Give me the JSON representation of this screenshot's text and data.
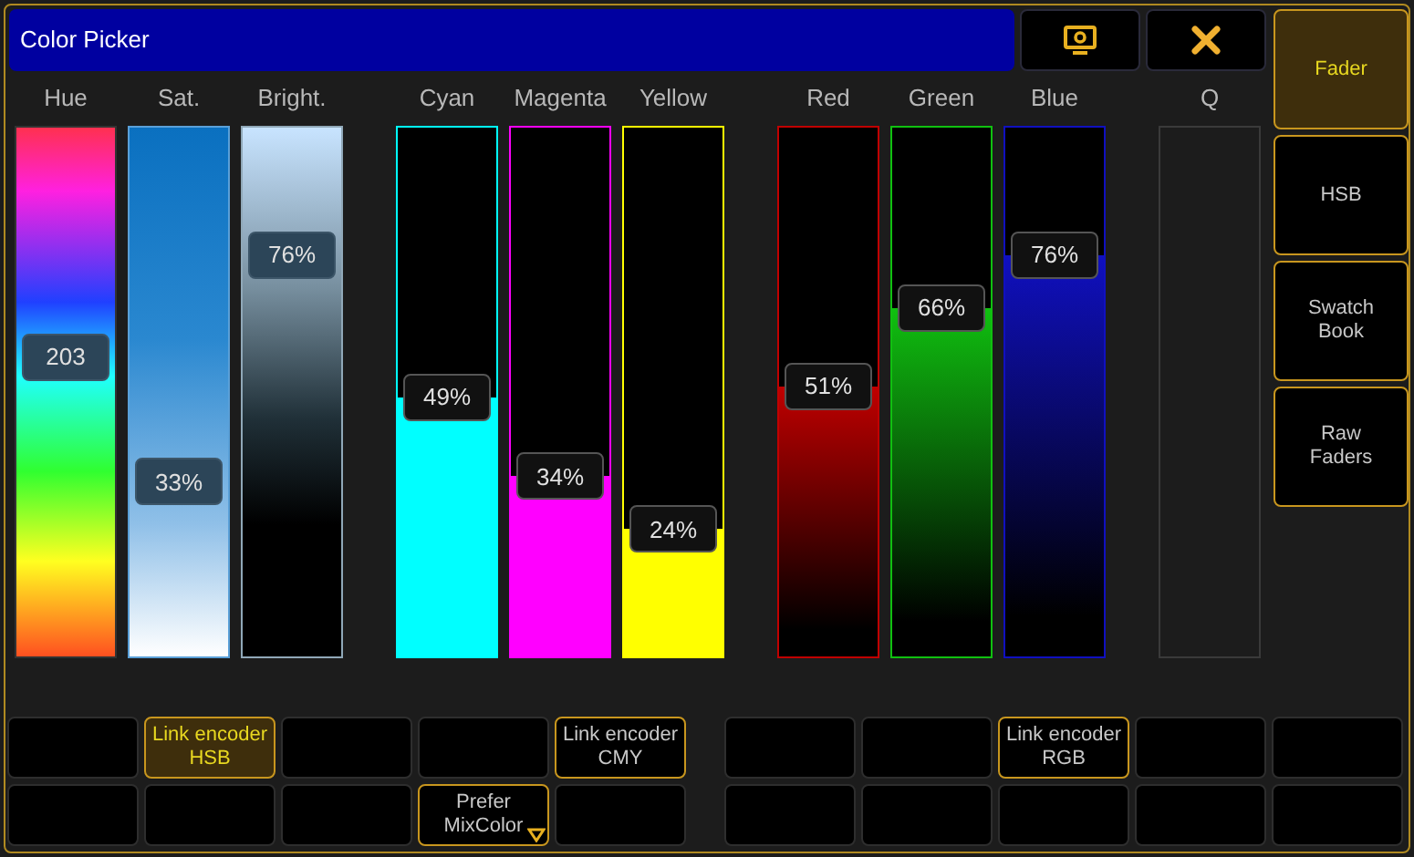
{
  "window": {
    "title": "Color Picker"
  },
  "fader_groups": [
    {
      "faders": [
        {
          "kind": "hue",
          "label": "Hue",
          "reading": "203",
          "level": 0.565
        },
        {
          "kind": "saturation",
          "label": "Sat.",
          "reading": "33%",
          "level": 0.33
        },
        {
          "kind": "brightness",
          "label": "Bright.",
          "reading": "76%",
          "level": 0.76
        }
      ]
    },
    {
      "faders": [
        {
          "kind": "solid",
          "label": "Cyan",
          "reading": "49%",
          "level": 0.49,
          "color": "#00ffff"
        },
        {
          "kind": "solid",
          "label": "Magenta",
          "reading": "34%",
          "level": 0.34,
          "color": "#ff00ff"
        },
        {
          "kind": "solid",
          "label": "Yellow",
          "reading": "24%",
          "level": 0.24,
          "color": "#ffff00"
        }
      ]
    },
    {
      "faders": [
        {
          "kind": "fade",
          "label": "Red",
          "reading": "51%",
          "level": 0.51,
          "color": "#c00000"
        },
        {
          "kind": "fade",
          "label": "Green",
          "reading": "66%",
          "level": 0.66,
          "color": "#10c010"
        },
        {
          "kind": "fade",
          "label": "Blue",
          "reading": "76%",
          "level": 0.76,
          "color": "#1010c0"
        }
      ]
    },
    {
      "faders": [
        {
          "kind": "empty",
          "label": "Q"
        }
      ]
    }
  ],
  "sidebar": {
    "items": [
      {
        "label": "Fader",
        "selected": true
      },
      {
        "label": "HSB",
        "selected": false
      },
      {
        "label": "Swatch Book",
        "selected": false
      },
      {
        "label": "Raw Faders",
        "selected": false
      }
    ]
  },
  "button_rows": [
    [
      {
        "kind": "blank"
      },
      {
        "kind": "button",
        "label": "Link encoder HSB",
        "selected": true
      },
      {
        "kind": "blank"
      },
      {
        "kind": "blank"
      },
      {
        "kind": "button",
        "label": "Link encoder CMY",
        "selected": false
      },
      {
        "kind": "blank"
      },
      {
        "kind": "blank"
      },
      {
        "kind": "button",
        "label": "Link encoder RGB",
        "selected": false
      },
      {
        "kind": "blank"
      },
      {
        "kind": "blank"
      }
    ],
    [
      {
        "kind": "blank"
      },
      {
        "kind": "blank"
      },
      {
        "kind": "blank"
      },
      {
        "kind": "dropdown",
        "label": "Prefer MixColor",
        "selected": false
      },
      {
        "kind": "blank"
      },
      {
        "kind": "blank"
      },
      {
        "kind": "blank"
      },
      {
        "kind": "blank"
      },
      {
        "kind": "blank"
      },
      {
        "kind": "blank"
      }
    ]
  ]
}
